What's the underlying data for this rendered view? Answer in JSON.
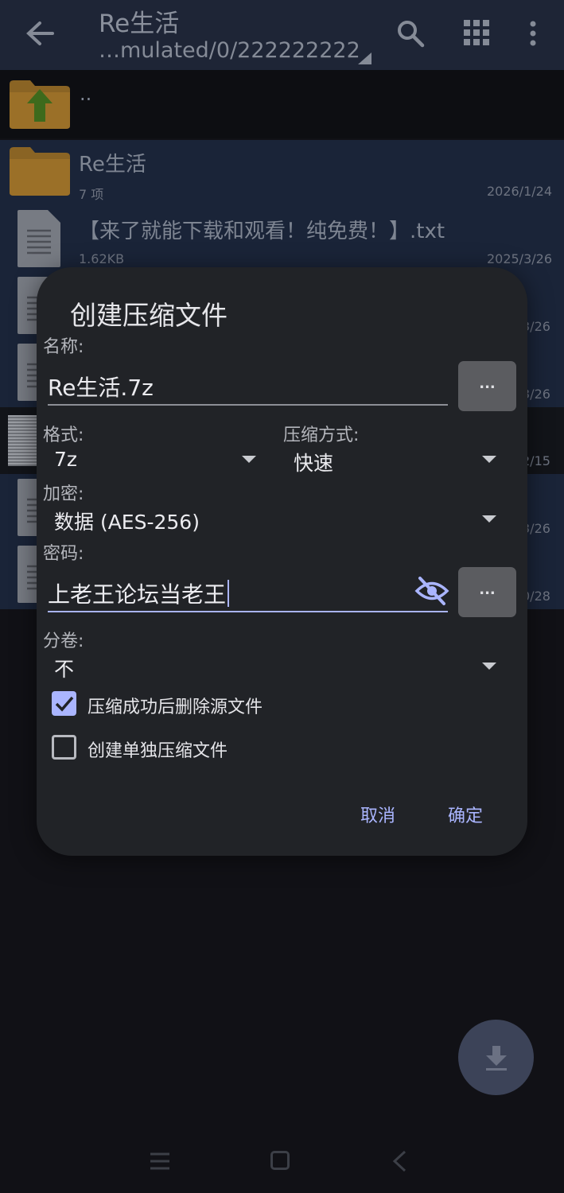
{
  "appbar": {
    "title": "Re生活",
    "path": "…mulated/0/222222222"
  },
  "list": {
    "parent_label": "..",
    "items": [
      {
        "name": "Re生活",
        "meta": "7 项",
        "date": "2026/1/24"
      },
      {
        "name": "【来了就能下载和观看！纯免费！】.txt",
        "meta": "1.62KB",
        "date": "2025/3/26"
      }
    ],
    "peek_dates": [
      "3/26",
      "3/26",
      "2/15",
      "3/26",
      "0/28"
    ]
  },
  "dialog": {
    "title": "创建压缩文件",
    "name_label": "名称:",
    "name_value": "Re生活.7z",
    "browse_label": "...",
    "format_label": "格式:",
    "format_value": "7z",
    "method_label": "压缩方式:",
    "method_value": "快速",
    "encrypt_label": "加密:",
    "encrypt_value": "数据 (AES-256)",
    "password_label": "密码:",
    "password_value": "上老王论坛当老王",
    "split_label": "分卷:",
    "split_value": "不",
    "checkbox_delete": {
      "label": "压缩成功后删除源文件",
      "checked": true
    },
    "checkbox_separate": {
      "label": "创建单独压缩文件",
      "checked": false
    },
    "cancel_label": "取消",
    "ok_label": "确定"
  },
  "colors": {
    "accent": "#aab5ff",
    "dialog_bg": "#212327",
    "appbar_bg": "#1e2536"
  }
}
